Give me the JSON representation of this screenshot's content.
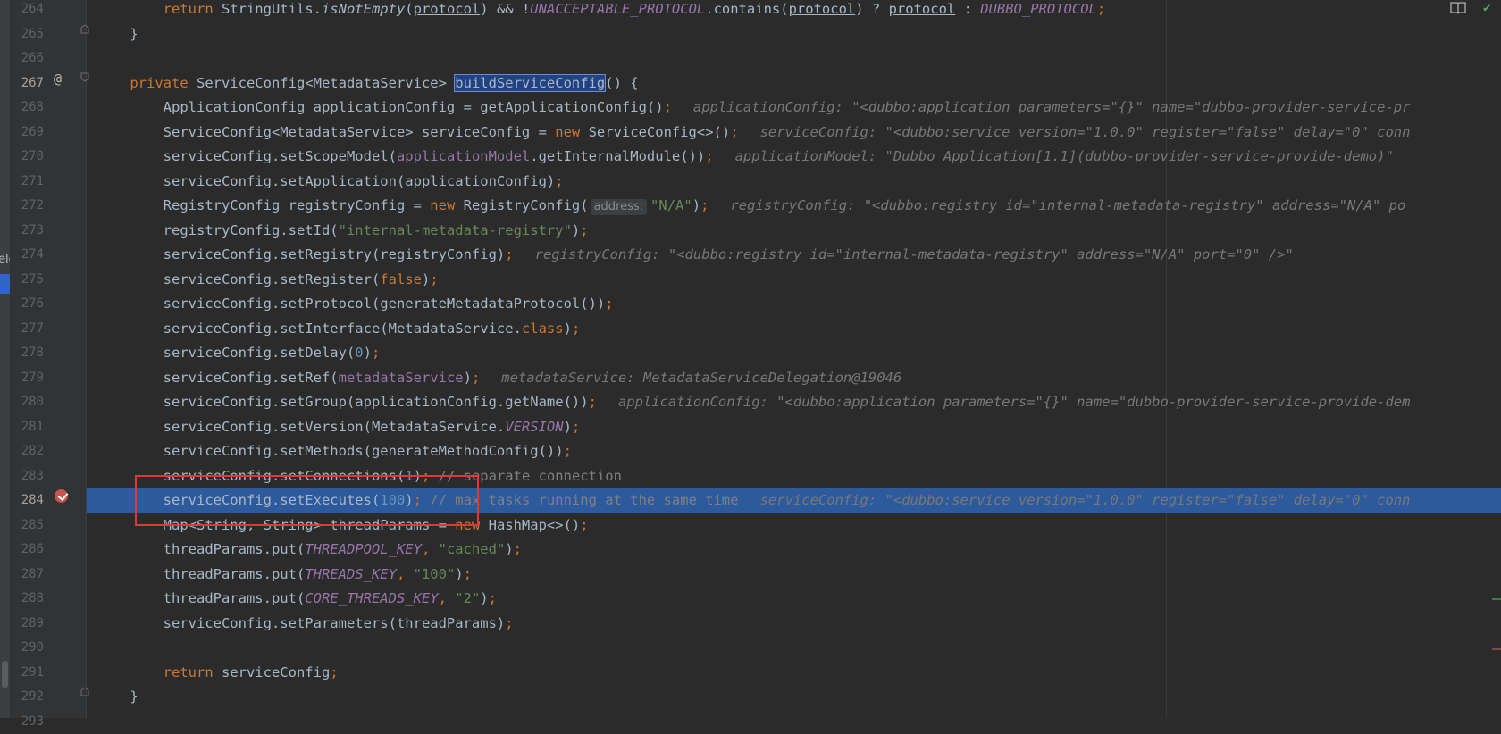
{
  "sidebar": {
    "fragment_text": "ele"
  },
  "lines": [
    {
      "num": "264",
      "top": 0,
      "segs": [
        [
          "plain",
          "        "
        ],
        [
          "k",
          "return "
        ],
        [
          "plain",
          "StringUtils."
        ],
        [
          "ital",
          "isNotEmpty"
        ],
        [
          "plain",
          "("
        ],
        [
          "u",
          "protocol"
        ],
        [
          "plain",
          ") && !"
        ],
        [
          "st",
          "UNACCEPTABLE_PROTOCOL"
        ],
        [
          "plain",
          ".contains("
        ],
        [
          "u",
          "protocol"
        ],
        [
          "plain",
          ") ? "
        ],
        [
          "u",
          "protocol"
        ],
        [
          "plain",
          " : "
        ],
        [
          "st",
          "DUBBO_PROTOCOL"
        ],
        [
          "k",
          ";"
        ]
      ]
    },
    {
      "num": "265",
      "top": 0,
      "segs": [
        [
          "plain",
          "    }"
        ]
      ]
    },
    {
      "num": "266",
      "top": 0,
      "segs": []
    },
    {
      "num": "267",
      "top": 0,
      "segs": [
        [
          "plain",
          "    "
        ],
        [
          "k",
          "private "
        ],
        [
          "plain",
          "ServiceConfig<MetadataService> "
        ],
        [
          "hl",
          "buildServiceConfig"
        ],
        [
          "plain",
          "() {"
        ]
      ]
    },
    {
      "num": "268",
      "top": 0,
      "segs": [
        [
          "plain",
          "        ApplicationConfig applicationConfig = getApplicationConfig()"
        ],
        [
          "k",
          ";"
        ],
        [
          "inlay",
          "applicationConfig: \"<dubbo:application parameters=\"{}\" name=\"dubbo-provider-service-pr"
        ]
      ]
    },
    {
      "num": "269",
      "top": 0,
      "segs": [
        [
          "plain",
          "        ServiceConfig<MetadataService> serviceConfig = "
        ],
        [
          "k",
          "new "
        ],
        [
          "plain",
          "ServiceConfig<>()"
        ],
        [
          "k",
          ";"
        ],
        [
          "inlay",
          "serviceConfig: \"<dubbo:service version=\"1.0.0\" register=\"false\" delay=\"0\" conn"
        ]
      ]
    },
    {
      "num": "270",
      "top": 0,
      "segs": [
        [
          "plain",
          "        serviceConfig.setScopeModel("
        ],
        [
          "fld",
          "applicationModel"
        ],
        [
          "plain",
          ".getInternalModule())"
        ],
        [
          "k",
          ";"
        ],
        [
          "inlay",
          "applicationModel: \"Dubbo Application[1.1](dubbo-provider-service-provide-demo)\""
        ]
      ]
    },
    {
      "num": "271",
      "top": 0,
      "segs": [
        [
          "plain",
          "        serviceConfig.setApplication(applicationConfig)"
        ],
        [
          "k",
          ";"
        ]
      ]
    },
    {
      "num": "272",
      "top": 0,
      "segs": [
        [
          "plain",
          "        RegistryConfig registryConfig = "
        ],
        [
          "k",
          "new "
        ],
        [
          "plain",
          "RegistryConfig("
        ],
        [
          "hint",
          "address:"
        ],
        [
          "s",
          "\"N/A\""
        ],
        [
          "plain",
          ")"
        ],
        [
          "k",
          ";"
        ],
        [
          "inlay",
          "registryConfig: \"<dubbo:registry id=\"internal-metadata-registry\" address=\"N/A\" po"
        ]
      ]
    },
    {
      "num": "273",
      "top": 0,
      "segs": [
        [
          "plain",
          "        registryConfig.setId("
        ],
        [
          "s",
          "\"internal-metadata-registry\""
        ],
        [
          "plain",
          ")"
        ],
        [
          "k",
          ";"
        ]
      ]
    },
    {
      "num": "274",
      "top": 0,
      "segs": [
        [
          "plain",
          "        serviceConfig.setRegistry(registryConfig)"
        ],
        [
          "k",
          ";"
        ],
        [
          "inlay",
          "registryConfig: \"<dubbo:registry id=\"internal-metadata-registry\" address=\"N/A\" port=\"0\" />\""
        ]
      ]
    },
    {
      "num": "275",
      "top": 0,
      "segs": [
        [
          "plain",
          "        serviceConfig.setRegister("
        ],
        [
          "k",
          "false"
        ],
        [
          "plain",
          ")"
        ],
        [
          "k",
          ";"
        ]
      ]
    },
    {
      "num": "276",
      "top": 0,
      "segs": [
        [
          "plain",
          "        serviceConfig.setProtocol(generateMetadataProtocol())"
        ],
        [
          "k",
          ";"
        ]
      ]
    },
    {
      "num": "277",
      "top": 0,
      "segs": [
        [
          "plain",
          "        serviceConfig.setInterface(MetadataService."
        ],
        [
          "k",
          "class"
        ],
        [
          "plain",
          ")"
        ],
        [
          "k",
          ";"
        ]
      ]
    },
    {
      "num": "278",
      "top": 0,
      "segs": [
        [
          "plain",
          "        serviceConfig.setDelay("
        ],
        [
          "n",
          "0"
        ],
        [
          "plain",
          ")"
        ],
        [
          "k",
          ";"
        ]
      ]
    },
    {
      "num": "279",
      "top": 0,
      "segs": [
        [
          "plain",
          "        serviceConfig.setRef("
        ],
        [
          "fld",
          "metadataService"
        ],
        [
          "plain",
          ")"
        ],
        [
          "k",
          ";"
        ],
        [
          "inlay",
          "metadataService: MetadataServiceDelegation@19046"
        ]
      ]
    },
    {
      "num": "280",
      "top": 0,
      "segs": [
        [
          "plain",
          "        serviceConfig.setGroup(applicationConfig.getName())"
        ],
        [
          "k",
          ";"
        ],
        [
          "inlay",
          "applicationConfig: \"<dubbo:application parameters=\"{}\" name=\"dubbo-provider-service-provide-dem"
        ]
      ]
    },
    {
      "num": "281",
      "top": 0,
      "segs": [
        [
          "plain",
          "        serviceConfig.setVersion(MetadataService."
        ],
        [
          "st",
          "VERSION"
        ],
        [
          "plain",
          ")"
        ],
        [
          "k",
          ";"
        ]
      ]
    },
    {
      "num": "282",
      "top": 0,
      "segs": [
        [
          "plain",
          "        serviceConfig.setMethods(generateMethodConfig())"
        ],
        [
          "k",
          ";"
        ]
      ]
    },
    {
      "num": "283",
      "top": 0,
      "segs": [
        [
          "plain",
          "        serviceConfig.setConnections("
        ],
        [
          "n",
          "1"
        ],
        [
          "plain",
          ")"
        ],
        [
          "k",
          "; "
        ],
        [
          "c",
          "// separate connection"
        ]
      ]
    },
    {
      "num": "284",
      "top": 0,
      "segs": [
        [
          "plain",
          "        serviceConfig.setExecutes("
        ],
        [
          "n",
          "100"
        ],
        [
          "plain",
          ")"
        ],
        [
          "k",
          "; "
        ],
        [
          "c",
          "// max tasks running at the same time"
        ],
        [
          "inlay",
          "serviceConfig: \"<dubbo:service version=\"1.0.0\" register=\"false\" delay=\"0\" conn"
        ]
      ]
    },
    {
      "num": "285",
      "top": 0,
      "segs": [
        [
          "plain",
          "        Map<String, String> threadParams = "
        ],
        [
          "k",
          "new "
        ],
        [
          "plain",
          "HashMap<>()"
        ],
        [
          "k",
          ";"
        ]
      ]
    },
    {
      "num": "286",
      "top": 0,
      "segs": [
        [
          "plain",
          "        threadParams.put("
        ],
        [
          "st",
          "THREADPOOL_KEY"
        ],
        [
          "k",
          ", "
        ],
        [
          "s",
          "\"cached\""
        ],
        [
          "plain",
          ")"
        ],
        [
          "k",
          ";"
        ]
      ]
    },
    {
      "num": "287",
      "top": 0,
      "segs": [
        [
          "plain",
          "        threadParams.put("
        ],
        [
          "st",
          "THREADS_KEY"
        ],
        [
          "k",
          ", "
        ],
        [
          "s",
          "\"100\""
        ],
        [
          "plain",
          ")"
        ],
        [
          "k",
          ";"
        ]
      ]
    },
    {
      "num": "288",
      "top": 0,
      "segs": [
        [
          "plain",
          "        threadParams.put("
        ],
        [
          "st",
          "CORE_THREADS_KEY"
        ],
        [
          "k",
          ", "
        ],
        [
          "s",
          "\"2\""
        ],
        [
          "plain",
          ")"
        ],
        [
          "k",
          ";"
        ]
      ]
    },
    {
      "num": "289",
      "top": 0,
      "segs": [
        [
          "plain",
          "        serviceConfig.setParameters(threadParams)"
        ],
        [
          "k",
          ";"
        ]
      ]
    },
    {
      "num": "290",
      "top": 0,
      "segs": []
    },
    {
      "num": "291",
      "top": 0,
      "segs": [
        [
          "plain",
          "        "
        ],
        [
          "k",
          "return "
        ],
        [
          "plain",
          "serviceConfig"
        ],
        [
          "k",
          ";"
        ]
      ]
    },
    {
      "num": "292",
      "top": 0,
      "segs": [
        [
          "plain",
          "    }"
        ]
      ]
    },
    {
      "num": "293",
      "top": 0,
      "segs": []
    }
  ],
  "current_line": "284",
  "colors": {
    "execution_line": "#2d5a9c",
    "annotation_box": "#e0383a",
    "breakpoint": "#c75450"
  }
}
